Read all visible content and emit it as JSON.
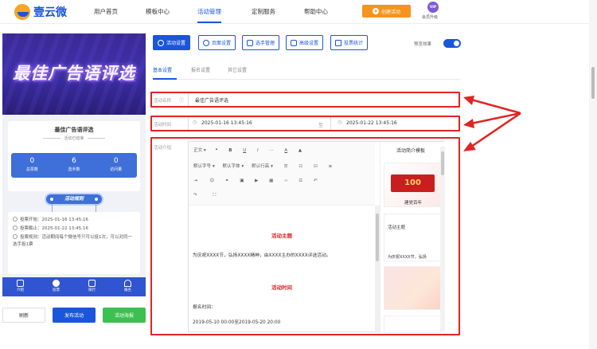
{
  "logo": {
    "text": "壹云微"
  },
  "nav": [
    "用户首页",
    "模板中心",
    "活动管理",
    "定制服务",
    "帮助中心"
  ],
  "nav_active": "活动管理",
  "create_button": "创建活动",
  "vip": {
    "badge": "VIP",
    "label": "会员升级"
  },
  "preview": {
    "banner_title": "最佳广告语评选",
    "card_title": "最佳广告语评选",
    "card_status": "活动已结束",
    "stats": [
      {
        "num": "0",
        "label": "总票数"
      },
      {
        "num": "6",
        "label": "选手数"
      },
      {
        "num": "0",
        "label": "访问量"
      }
    ],
    "rules_button": "活动规则",
    "rules": [
      "投票开始：2025-01-16 13:45:16",
      "投票截止：2025-01-22 13:45:16",
      "投票规则：活动期间每个微信号只可以投1次，可以对同一选手投1票"
    ],
    "tabbar": [
      "介绍",
      "投票",
      "排行",
      "报名"
    ]
  },
  "bottom_buttons": {
    "refresh": "刷新",
    "publish": "发布活动",
    "poster": "活动海报"
  },
  "toolbar": [
    "活动设置",
    "页面设置",
    "选手管理",
    "高级设置",
    "投票统计"
  ],
  "preview_toggle_label": "预览效果",
  "subtabs": [
    "基本设置",
    "报名设置",
    "其它设置"
  ],
  "form": {
    "name_label": "活动名称",
    "name_value": "最佳广告语评选",
    "time_label": "活动时间",
    "start": "2025-01-16 13:45:16",
    "to": "至",
    "end": "2025-01-22 13:45:16",
    "intro_label": "活动介绍"
  },
  "editor": {
    "row1": [
      "正文",
      "❝",
      "B",
      "U",
      "I",
      "···",
      "A",
      "▲"
    ],
    "font_size": "默认字号",
    "font_family": "默认字体",
    "line_height": "默认行高",
    "heading1": "活动主题",
    "para1": "为庆祝XXXX节，弘扬XXXX精神，由XXXX主办的XXXX评选活动。",
    "heading2": "活动时间",
    "para2": "报名时间：",
    "para3": "2019-05-10 00:00至2019-05-20 20:00"
  },
  "templates": {
    "title": "活动简介模板",
    "card1_caption": "建党百年",
    "card2_title": "活动主题",
    "card2_text": "为庆祝XXXX节，弘扬"
  },
  "colors": {
    "brand": "#1a56db",
    "orange": "#f7931e",
    "green": "#3cc051",
    "red": "#e02424"
  }
}
